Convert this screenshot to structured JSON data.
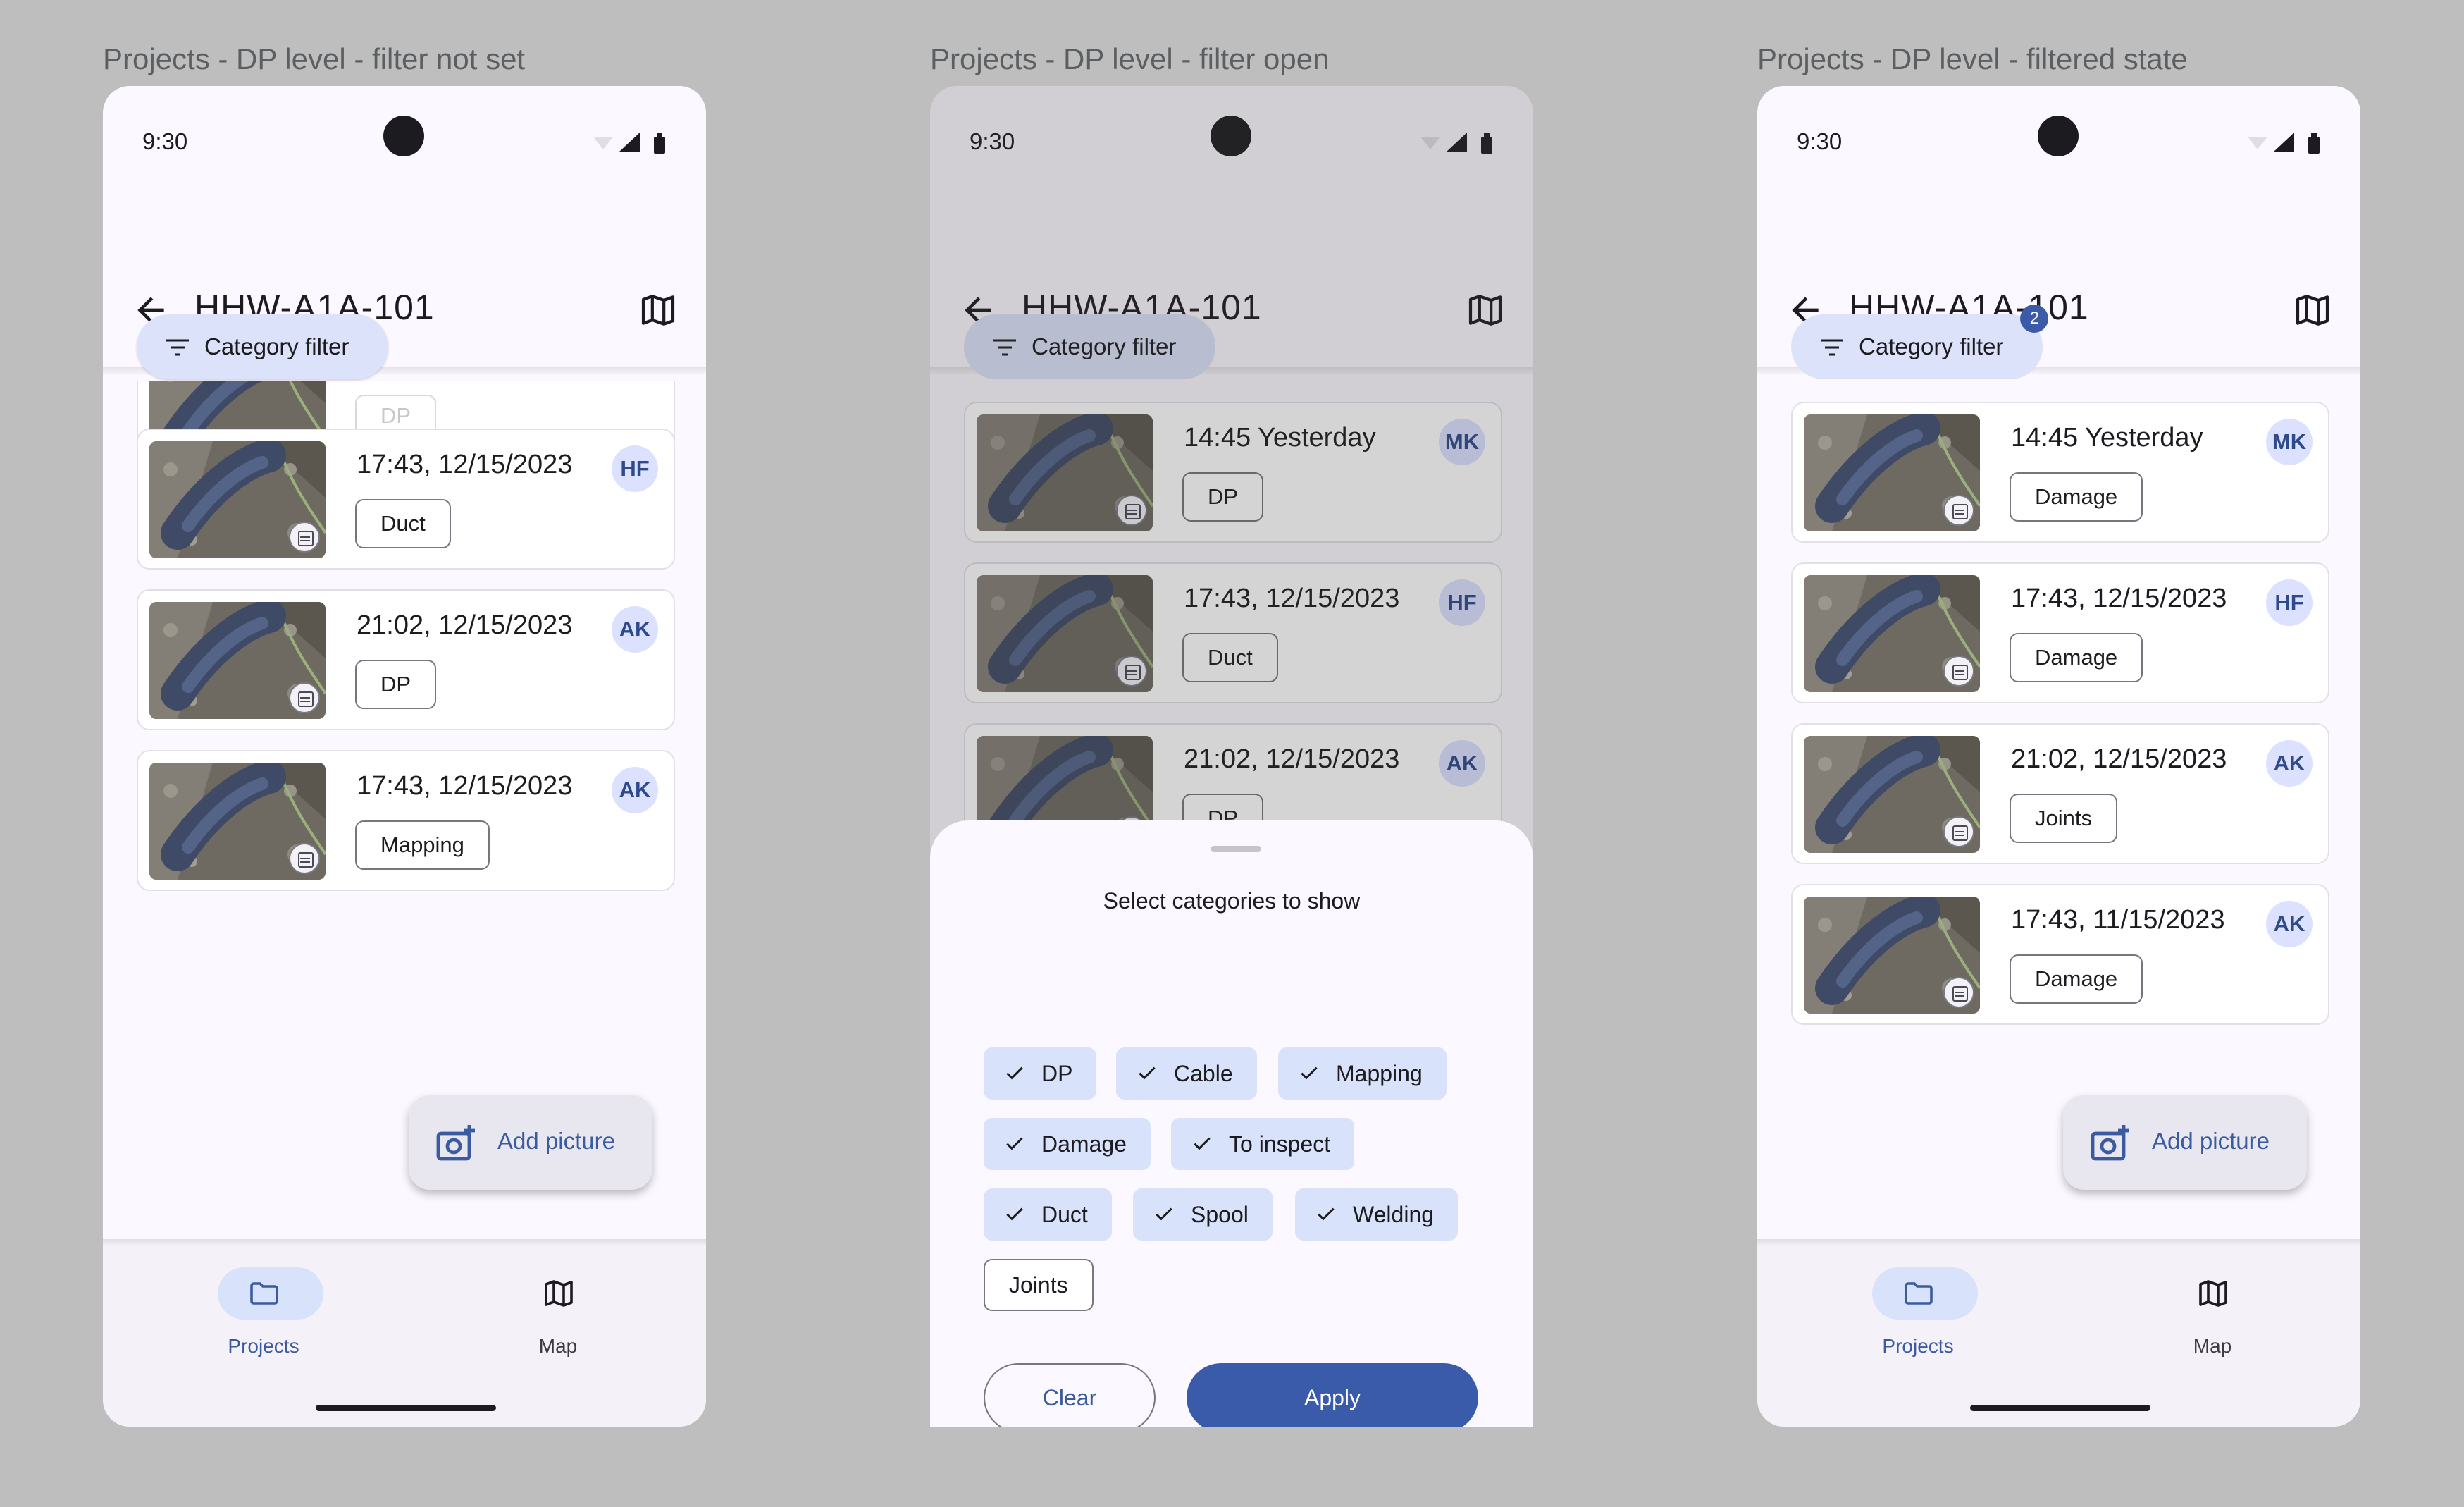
{
  "frames": [
    {
      "label": "Projects - DP level - filter not set",
      "time": "9:30",
      "title": "HHW-A1A-101",
      "filter_label": "Category filter",
      "partial_chip": "DP",
      "cards": [
        {
          "timestamp": "17:43, 12/15/2023",
          "category": "Duct",
          "initials": "HF"
        },
        {
          "timestamp": "21:02, 12/15/2023",
          "category": "DP",
          "initials": "AK"
        },
        {
          "timestamp": "17:43, 12/15/2023",
          "category": "Mapping",
          "initials": "AK"
        }
      ],
      "fab_label": "Add picture",
      "nav": [
        {
          "label": "Projects",
          "icon": "folder-icon"
        },
        {
          "label": "Map",
          "icon": "map-icon"
        }
      ]
    },
    {
      "label": "Projects - DP level - filter open",
      "time": "9:30",
      "title": "HHW-A1A-101",
      "filter_label": "Category filter",
      "cards": [
        {
          "timestamp": "14:45 Yesterday",
          "category": "DP",
          "initials": "MK"
        },
        {
          "timestamp": "17:43, 12/15/2023",
          "category": "Duct",
          "initials": "HF"
        },
        {
          "timestamp": "21:02, 12/15/2023",
          "category": "DP",
          "initials": "AK"
        }
      ],
      "sheet": {
        "title": "Select categories to show",
        "chips": [
          {
            "label": "DP",
            "selected": true
          },
          {
            "label": "Cable",
            "selected": true
          },
          {
            "label": "Mapping",
            "selected": true
          },
          {
            "label": "Damage",
            "selected": true
          },
          {
            "label": "To inspect",
            "selected": true
          },
          {
            "label": "Duct",
            "selected": true
          },
          {
            "label": "Spool",
            "selected": true
          },
          {
            "label": "Welding",
            "selected": true
          },
          {
            "label": "Joints",
            "selected": false
          }
        ],
        "clear_label": "Clear",
        "apply_label": "Apply"
      }
    },
    {
      "label": "Projects - DP level - filtered state",
      "time": "9:30",
      "title": "HHW-A1A-101",
      "filter_label": "Category filter",
      "filter_badge": "2",
      "cards": [
        {
          "timestamp": "14:45 Yesterday",
          "category": "Damage",
          "initials": "MK"
        },
        {
          "timestamp": "17:43, 12/15/2023",
          "category": "Damage",
          "initials": "HF"
        },
        {
          "timestamp": "21:02, 12/15/2023",
          "category": "Joints",
          "initials": "AK"
        },
        {
          "timestamp": "17:43, 11/15/2023",
          "category": "Damage",
          "initials": "AK"
        }
      ],
      "fab_label": "Add picture",
      "nav": [
        {
          "label": "Projects",
          "icon": "folder-icon"
        },
        {
          "label": "Map",
          "icon": "map-icon"
        }
      ]
    }
  ],
  "colors": {
    "background": "#bdbebd",
    "surface": "#fbf8ff",
    "primary": "#3a5ba9",
    "chip_selected": "#d8e2fb",
    "avatar": "#dbe1ff"
  }
}
